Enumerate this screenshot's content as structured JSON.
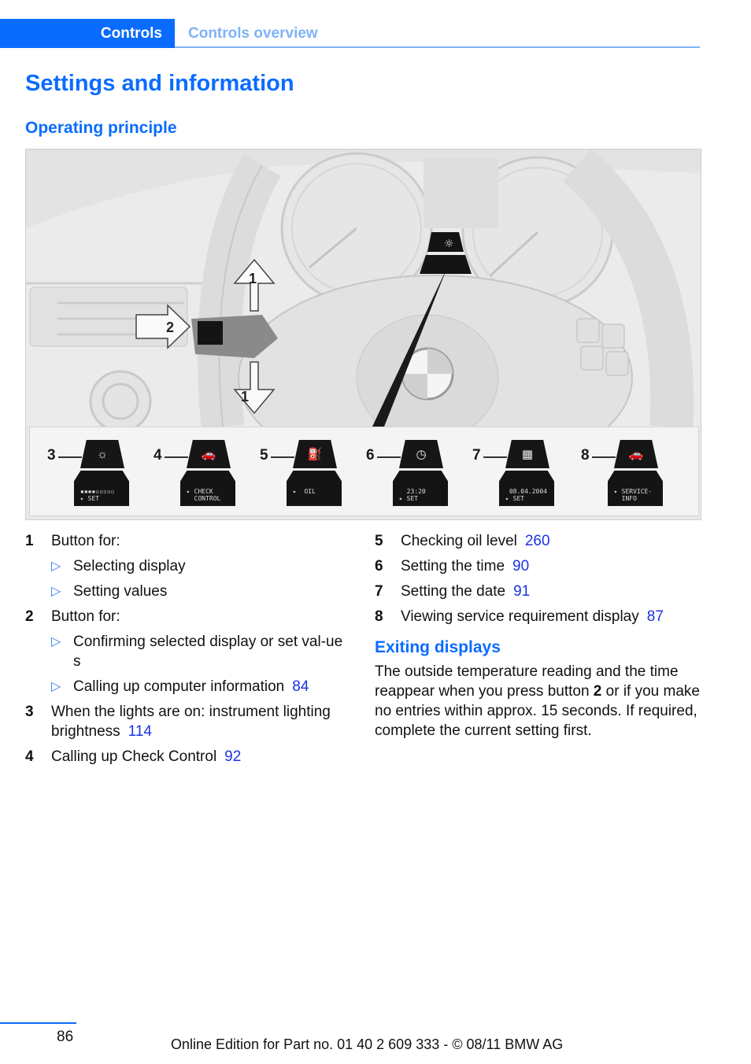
{
  "header": {
    "section": "Controls",
    "subsection": "Controls overview"
  },
  "title": "Settings and information",
  "operating_principle": {
    "heading": "Operating principle",
    "illustration": {
      "callouts_top": [
        "1",
        "2",
        "1"
      ],
      "displays": [
        {
          "number": "3",
          "icon": "brightness-icon",
          "symbol": "☼",
          "text": "▪▪▪▪▫▫▫▫▫\n▸ SET"
        },
        {
          "number": "4",
          "icon": "car-icon",
          "symbol": "🚗",
          "text": "▸ CHECK\n  CONTROL"
        },
        {
          "number": "5",
          "icon": "oil-can-icon",
          "symbol": "⛽",
          "text": "▸  OIL"
        },
        {
          "number": "6",
          "icon": "clock-icon",
          "symbol": "◷",
          "text": "  23:20\n▸ SET"
        },
        {
          "number": "7",
          "icon": "calendar-icon",
          "symbol": "▦",
          "text": " 08.04.2004\n▸ SET"
        },
        {
          "number": "8",
          "icon": "car-service-icon",
          "symbol": "🚗",
          "text": "▸ SERVICE-\n  INFO"
        }
      ]
    }
  },
  "left_list": {
    "item1": {
      "num": "1",
      "text": "Button for:",
      "subs": [
        "Selecting display",
        "Setting values"
      ]
    },
    "item2": {
      "num": "2",
      "text": "Button for:",
      "subs": [
        "Confirming selected display or set val-ues",
        "Calling up computer information"
      ],
      "sub2_ref": "84"
    },
    "item3": {
      "num": "3",
      "text": "When the lights are on: instrument lighting brightness",
      "ref": "114"
    },
    "item4": {
      "num": "4",
      "text": "Calling up Check Control",
      "ref": "92"
    }
  },
  "right_list": {
    "item5": {
      "num": "5",
      "text": "Checking oil level",
      "ref": "260"
    },
    "item6": {
      "num": "6",
      "text": "Setting the time",
      "ref": "90"
    },
    "item7": {
      "num": "7",
      "text": "Setting the date",
      "ref": "91"
    },
    "item8": {
      "num": "8",
      "text": "Viewing service requirement display",
      "ref": "87"
    }
  },
  "exiting": {
    "heading": "Exiting displays",
    "text_before": "The outside temperature reading and the time reappear when you press button ",
    "bold": "2",
    "text_after": " or if you make no entries within approx. 15 seconds. If required, complete the current setting first."
  },
  "footer": {
    "page": "86",
    "edition": "Online Edition for Part no. 01 40 2 609 333 - © 08/11 BMW AG"
  },
  "colors": {
    "accent": "#0a6cff",
    "accent_light": "#7fb3f7",
    "page_ref": "#1a33e6"
  }
}
